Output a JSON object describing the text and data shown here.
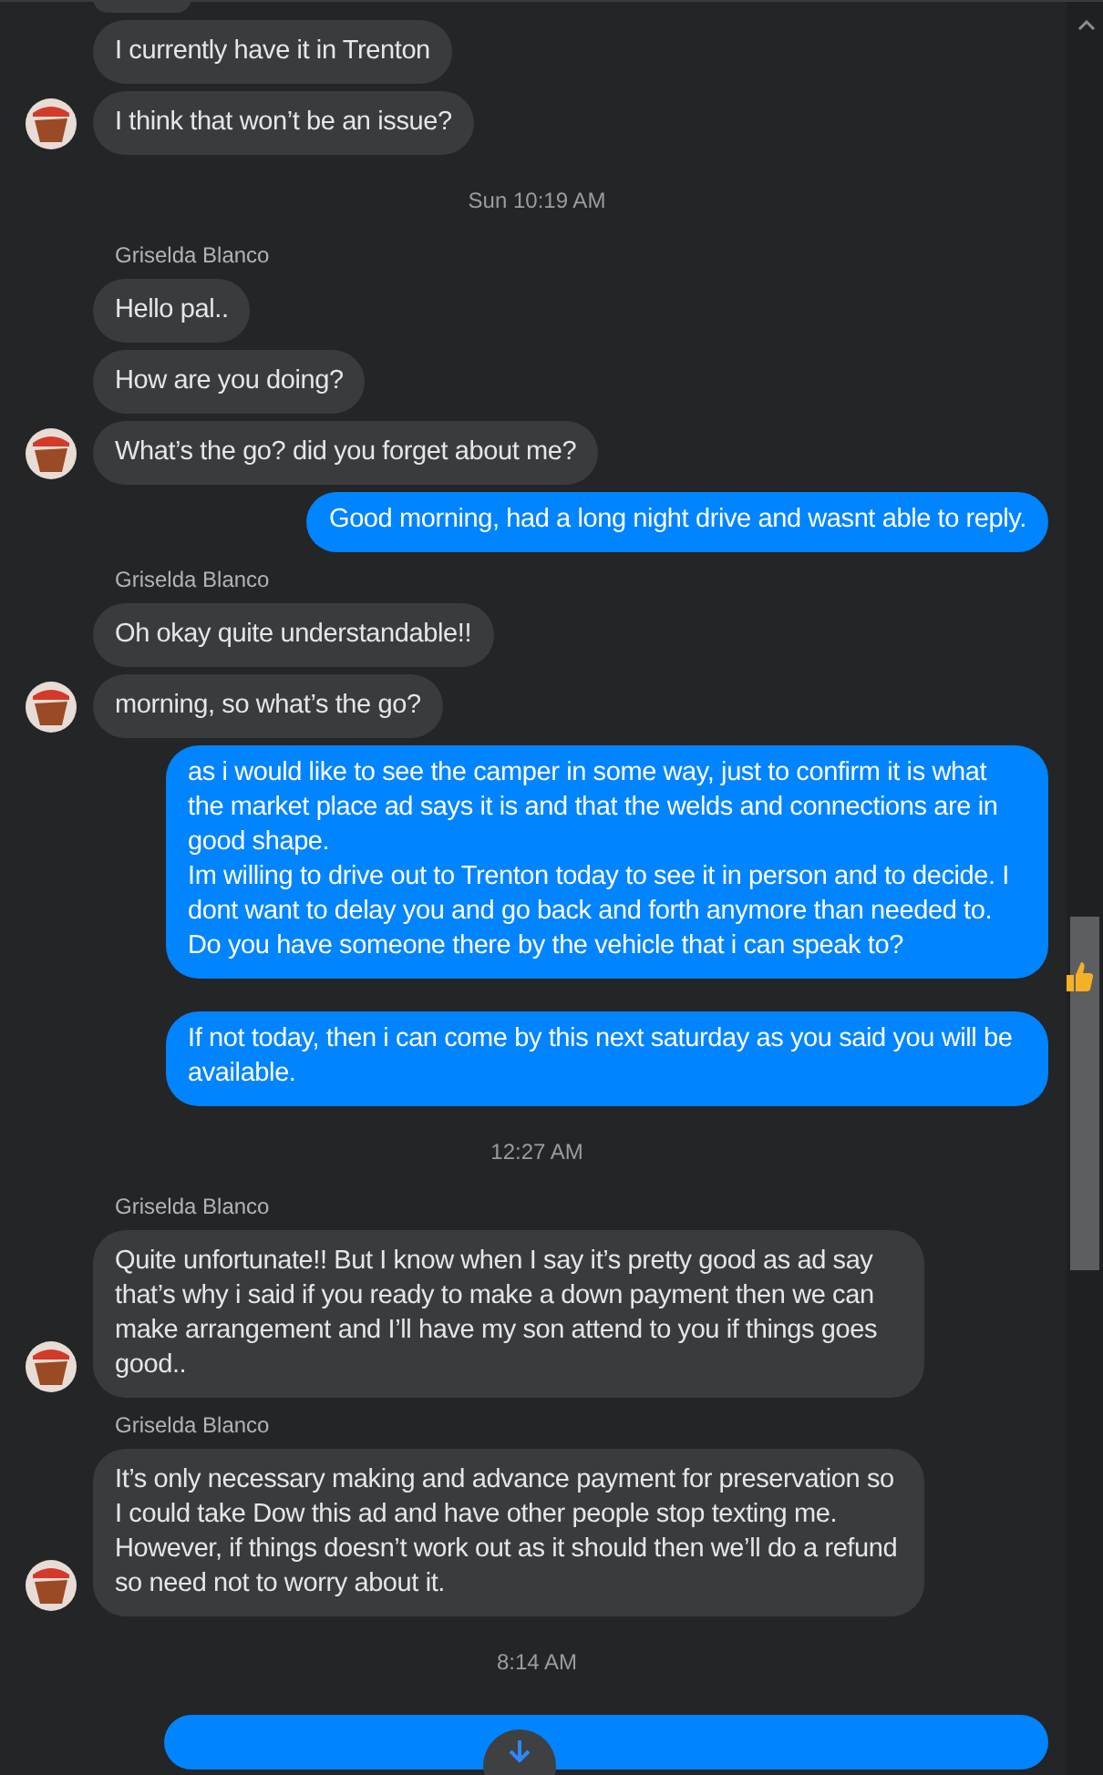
{
  "items": [
    {
      "kind": "incoming",
      "messages": [
        "I currently have it in Trenton",
        "I think that won’t be an issue?"
      ]
    },
    {
      "kind": "time",
      "text": "Sun 10:19 AM"
    },
    {
      "kind": "incoming",
      "sender": "Griselda Blanco",
      "messages": [
        "Hello pal..",
        "How are you doing?",
        "What’s the go? did you forget about me?"
      ]
    },
    {
      "kind": "outgoing",
      "messages": [
        {
          "text": "Good morning, had a long night drive and wasnt able to reply.",
          "reacted": false
        }
      ]
    },
    {
      "kind": "incoming",
      "sender": "Griselda Blanco",
      "messages": [
        "Oh okay quite understandable!!",
        "morning, so what’s the go?"
      ]
    },
    {
      "kind": "outgoing",
      "messages": [
        {
          "text": "as i would like to see the camper in some way, just to confirm it is what the market place ad says it is and that the welds and connections are in good shape.\nIm willing to drive out to Trenton today to see it in person and to decide. I dont want to delay you and go back and forth anymore than needed to. Do you have someone there by the vehicle that i can speak to?",
          "reacted": true
        },
        {
          "text": "If not today, then i can come by this next saturday as you said you will be available.",
          "reacted": false
        }
      ]
    },
    {
      "kind": "time",
      "text": "12:27 AM"
    },
    {
      "kind": "incoming",
      "sender": "Griselda Blanco",
      "messages": [
        "Quite unfortunate!! But I know when I say it’s pretty good as ad say that’s why i said if you ready to make a down payment then we can make arrangement and I’ll have my son attend to you if things goes good.."
      ]
    },
    {
      "kind": "incoming",
      "sender": "Griselda Blanco",
      "messages": [
        "It’s only necessary making and advance payment for preservation so I could take Dow this ad and have other people stop texting me. However, if things doesn’t work out as it should then we’ll do a refund so need not to worry about it."
      ]
    },
    {
      "kind": "time",
      "text": "8:14 AM"
    }
  ]
}
